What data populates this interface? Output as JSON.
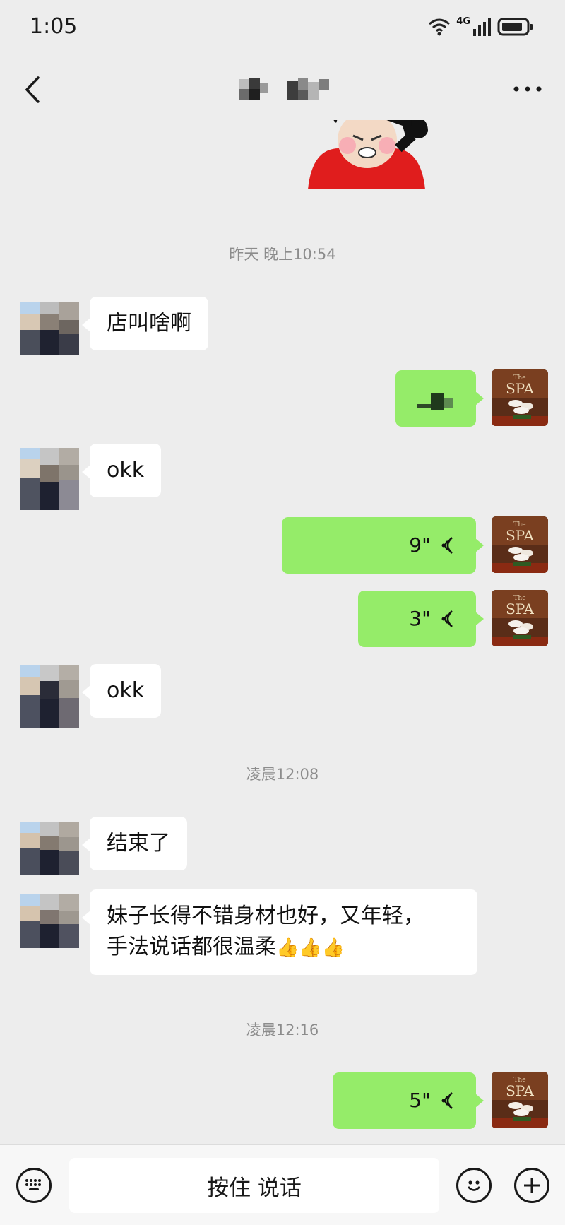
{
  "status_bar": {
    "time": "1:05",
    "network": "4G",
    "icons": [
      "wifi-icon",
      "signal-icon",
      "battery-icon"
    ]
  },
  "header": {
    "back_icon": "chevron-left-icon",
    "title": "",
    "more_icon": "more-dots-icon"
  },
  "messages": [
    {
      "type": "sticker",
      "side": "right",
      "description_icon": "angry-face-sticker"
    },
    {
      "type": "time",
      "text": "昨天 晚上10:54"
    },
    {
      "type": "text",
      "side": "left",
      "text": "店叫啥啊"
    },
    {
      "type": "text",
      "side": "right",
      "text": ""
    },
    {
      "type": "text",
      "side": "left",
      "text": "okk"
    },
    {
      "type": "voice",
      "side": "right",
      "duration": "9\""
    },
    {
      "type": "voice",
      "side": "right",
      "duration": "3\""
    },
    {
      "type": "text",
      "side": "left",
      "text": "okk"
    },
    {
      "type": "time",
      "text": "凌晨12:08"
    },
    {
      "type": "text",
      "side": "left",
      "text": "结束了"
    },
    {
      "type": "text",
      "side": "left",
      "line1": "妹子长得不错身材也好，又年轻，",
      "line2": "手法说话都很温柔",
      "emoji": "👍👍👍"
    },
    {
      "type": "time",
      "text": "凌晨12:16"
    },
    {
      "type": "voice",
      "side": "right",
      "duration": "5\""
    }
  ],
  "self_avatar": {
    "text_small": "The",
    "text": "SPA"
  },
  "input_bar": {
    "keyboard_icon": "keyboard-icon",
    "hold_to_talk_label": "按住 说话",
    "emoji_icon": "emoji-icon",
    "plus_icon": "plus-icon"
  },
  "colors": {
    "background": "#ededed",
    "self_bubble": "#95ec69",
    "other_bubble": "#ffffff"
  }
}
